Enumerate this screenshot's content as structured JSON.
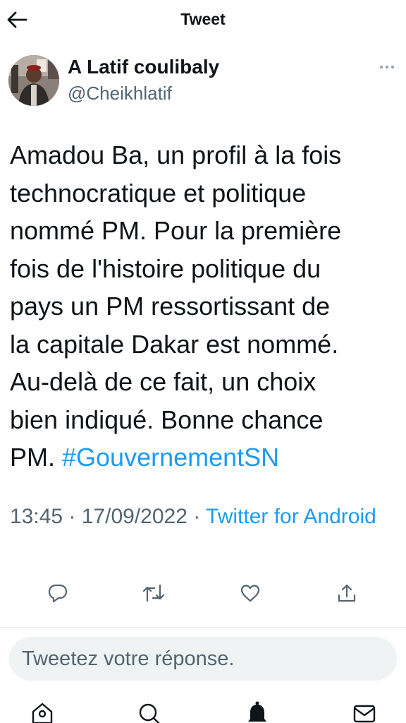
{
  "header": {
    "title": "Tweet",
    "back_icon": "arrow-left-icon"
  },
  "author": {
    "name": "A Latif coulibaly",
    "handle": "@Cheikhlatif",
    "more_icon": "more-horizontal-icon"
  },
  "tweet": {
    "lines": [
      "Amadou Ba, un profil à la fois",
      "technocratique et politique",
      "nommé PM. Pour la première",
      "fois de l'histoire politique du",
      "pays un PM ressortissant de",
      "la capitale Dakar est nommé.",
      "Au-delà de ce fait, un choix",
      "bien indiqué. Bonne chance"
    ],
    "last_line_prefix": "PM. ",
    "hashtag": "#GouvernementSN"
  },
  "meta": {
    "time": "13:45",
    "separator": " · ",
    "date": "17/09/2022",
    "source": "Twitter for Android"
  },
  "actions": [
    {
      "name": "reply-icon"
    },
    {
      "name": "retweet-icon"
    },
    {
      "name": "like-icon"
    },
    {
      "name": "share-icon"
    }
  ],
  "reply": {
    "placeholder": "Tweetez votre réponse."
  },
  "bottom_nav": [
    {
      "name": "home-icon"
    },
    {
      "name": "search-icon"
    },
    {
      "name": "notifications-icon"
    },
    {
      "name": "messages-icon"
    }
  ],
  "colors": {
    "accent": "#1d9bf0",
    "text": "#0f1419",
    "secondary": "#536471",
    "reply_bg": "#eff3f4",
    "divider": "#e7e9ea"
  }
}
